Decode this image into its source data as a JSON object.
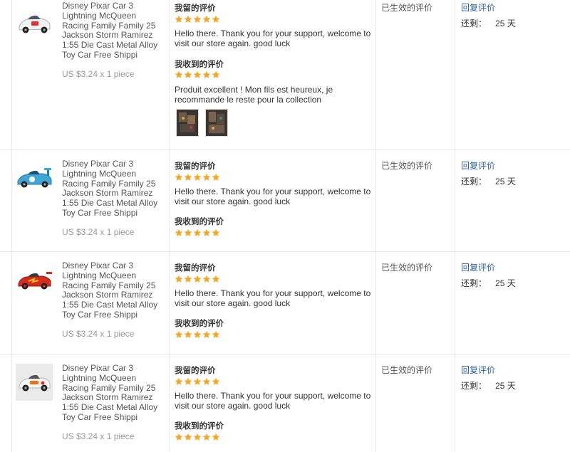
{
  "colors": {
    "star": "#f5a623",
    "link": "#2b5fa5",
    "price": "#999999",
    "border": "#e8e8e8"
  },
  "orders": [
    {
      "product": {
        "title": "Disney Pixar Car 3 Lightning McQueen Racing Family Family 25 Jackson Storm Ramirez 1:55 Die Cast Metal Alloy Toy Car Free Shippi",
        "price": "US $3.24 x 1 piece",
        "image": "white-race-car-icon"
      },
      "my_feedback": {
        "heading": "我留的评价",
        "rating": 5,
        "text": "Hello there. Thank you for your support, welcome to visit our store again. good luck"
      },
      "received_feedback": {
        "heading": "我收到的评价",
        "rating": 5,
        "text": "Produit excellent ! Mon fils est heureux, je recommande le reste pour la collection",
        "photos": [
          "buyer-photo-icon",
          "buyer-photo-icon"
        ]
      },
      "status": "已生效的评价",
      "reply_label": "回复评价",
      "remaining_label": "还剩：",
      "remaining_value": "25 天"
    },
    {
      "product": {
        "title": "Disney Pixar Car 3 Lightning McQueen Racing Family Family 25 Jackson Storm Ramirez 1:55 Die Cast Metal Alloy Toy Car Free Shippi",
        "price": "US $3.24 x 1 piece",
        "image": "blue-race-car-icon"
      },
      "my_feedback": {
        "heading": "我留的评价",
        "rating": 5,
        "text": "Hello there. Thank you for your support, welcome to visit our store again. good luck"
      },
      "received_feedback": {
        "heading": "我收到的评价",
        "rating": 5
      },
      "status": "已生效的评价",
      "reply_label": "回复评价",
      "remaining_label": "还剩：",
      "remaining_value": "25 天"
    },
    {
      "product": {
        "title": "Disney Pixar Car 3 Lightning McQueen Racing Family Family 25 Jackson Storm Ramirez 1:55 Die Cast Metal Alloy Toy Car Free Shippi",
        "price": "US $3.24 x 1 piece",
        "image": "red-race-car-icon"
      },
      "my_feedback": {
        "heading": "我留的评价",
        "rating": 5,
        "text": "Hello there. Thank you for your support, welcome to visit our store again. good luck"
      },
      "received_feedback": {
        "heading": "我收到的评价",
        "rating": 5
      },
      "status": "已生效的评价",
      "reply_label": "回复评价",
      "remaining_label": "还剩：",
      "remaining_value": "25 天"
    },
    {
      "product": {
        "title": "Disney Pixar Car 3 Lightning McQueen Racing Family Family 25 Jackson Storm Ramirez 1:55 Die Cast Metal Alloy Toy Car Free Shippi",
        "price": "US $3.24 x 1 piece",
        "image": "white-orange-race-car-icon"
      },
      "my_feedback": {
        "heading": "我留的评价",
        "rating": 5,
        "text": "Hello there. Thank you for your support, welcome to visit our store again. good luck"
      },
      "received_feedback": {
        "heading": "我收到的评价",
        "rating": 5
      },
      "status": "已生效的评价",
      "reply_label": "回复评价",
      "remaining_label": "还剩：",
      "remaining_value": "25 天"
    }
  ]
}
